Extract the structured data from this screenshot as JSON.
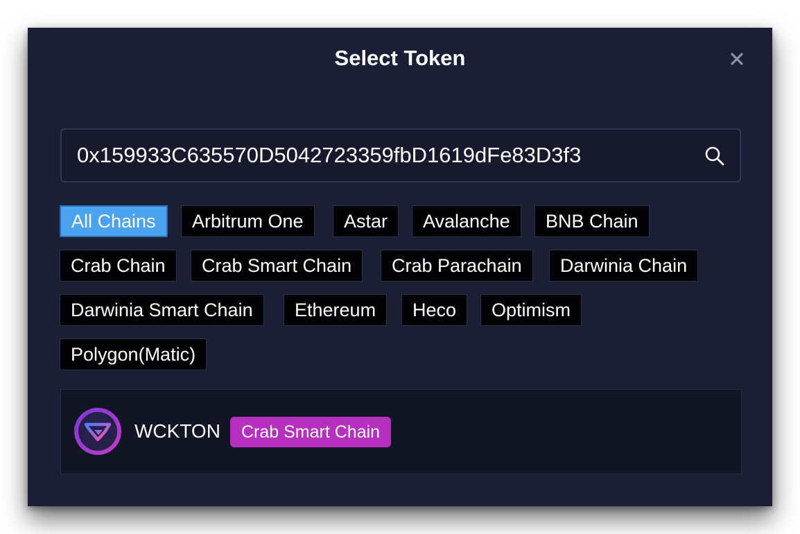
{
  "modal": {
    "title": "Select Token",
    "close_icon": "close-icon"
  },
  "search": {
    "value": "0x159933C635570D5042723359fbD1619dFe83D3f3",
    "icon": "search-icon"
  },
  "chain_filters": [
    {
      "label": "All Chains",
      "active": true
    },
    {
      "label": "Arbitrum One",
      "active": false
    },
    {
      "label": "Astar",
      "active": false
    },
    {
      "label": "Avalanche",
      "active": false
    },
    {
      "label": "BNB Chain",
      "active": false
    },
    {
      "label": "Crab Chain",
      "active": false
    },
    {
      "label": "Crab Smart Chain",
      "active": false
    },
    {
      "label": "Crab Parachain",
      "active": false
    },
    {
      "label": "Darwinia Chain",
      "active": false
    },
    {
      "label": "Darwinia Smart Chain",
      "active": false
    },
    {
      "label": "Ethereum",
      "active": false
    },
    {
      "label": "Heco",
      "active": false
    },
    {
      "label": "Optimism",
      "active": false
    },
    {
      "label": "Polygon(Matic)",
      "active": false
    }
  ],
  "results": [
    {
      "symbol": "WCKTON",
      "chain": "Crab Smart Chain",
      "icon": "wckton-token-logo",
      "badge_color": "#b62fbe"
    }
  ],
  "colors": {
    "modal_bg": "#1b1f36",
    "active_chip": "#4ba3f0",
    "chip_bg": "#030306"
  }
}
